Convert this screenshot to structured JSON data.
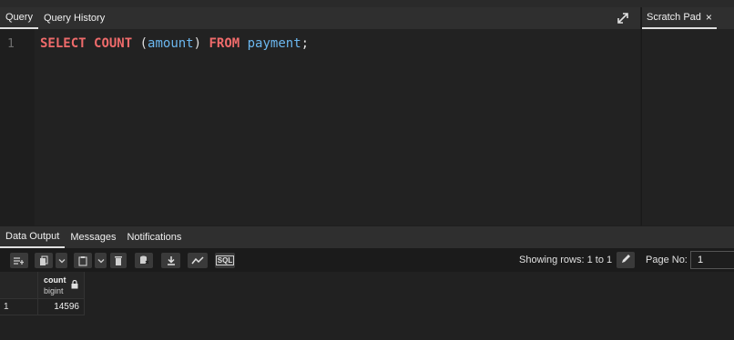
{
  "query_tabs": {
    "query": "Query",
    "history": "Query History"
  },
  "scratch_pad": {
    "label": "Scratch Pad",
    "close": "×"
  },
  "editor": {
    "line_number": "1",
    "tokens": {
      "select": "SELECT",
      "count": "COUNT",
      "paren_open": " (",
      "arg": "amount",
      "paren_close": ") ",
      "from": "FROM",
      "table": "payment",
      "semicolon": ";"
    }
  },
  "output_tabs": {
    "data_output": "Data Output",
    "messages": "Messages",
    "notifications": "Notifications"
  },
  "toolbar": {
    "sql_label": "SQL",
    "showing_rows": "Showing rows: 1 to 1",
    "page_no_label": "Page No:",
    "page_no_value": "1"
  },
  "grid": {
    "columns": [
      {
        "name": "count",
        "type": "bigint"
      }
    ],
    "rows": [
      {
        "row_number": "1",
        "values": [
          "14596"
        ]
      }
    ]
  },
  "colors": {
    "keyword": "#ef6b6b",
    "identifier": "#6bb7ef",
    "background": "#1e1e1e",
    "panel": "#2f2f2f"
  }
}
